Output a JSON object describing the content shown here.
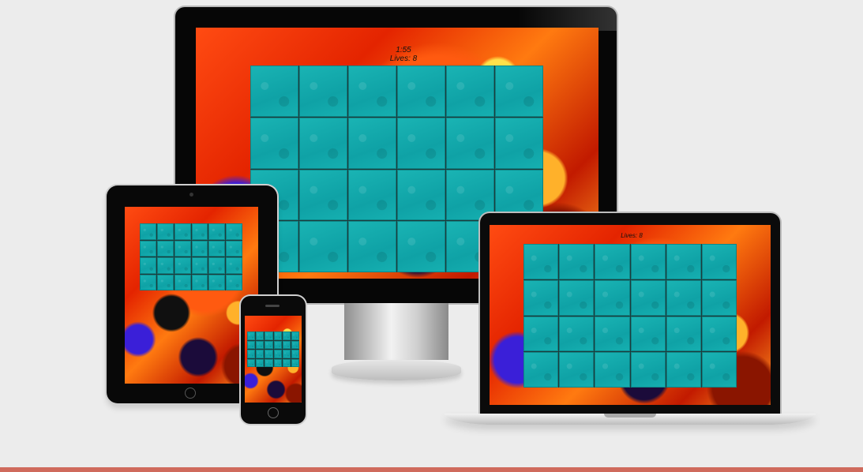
{
  "desktop_hud": {
    "timer": "1:55",
    "lives": "Lives: 8"
  },
  "laptop_hud": {
    "lives": "Lives: 8"
  },
  "board": {
    "columns": 6,
    "rows": 4,
    "tile_color": "#12a9ab"
  },
  "colors": {
    "page_background": "#ececec",
    "bottom_rule": "#cf6a5c",
    "device_bezel": "#060606"
  }
}
